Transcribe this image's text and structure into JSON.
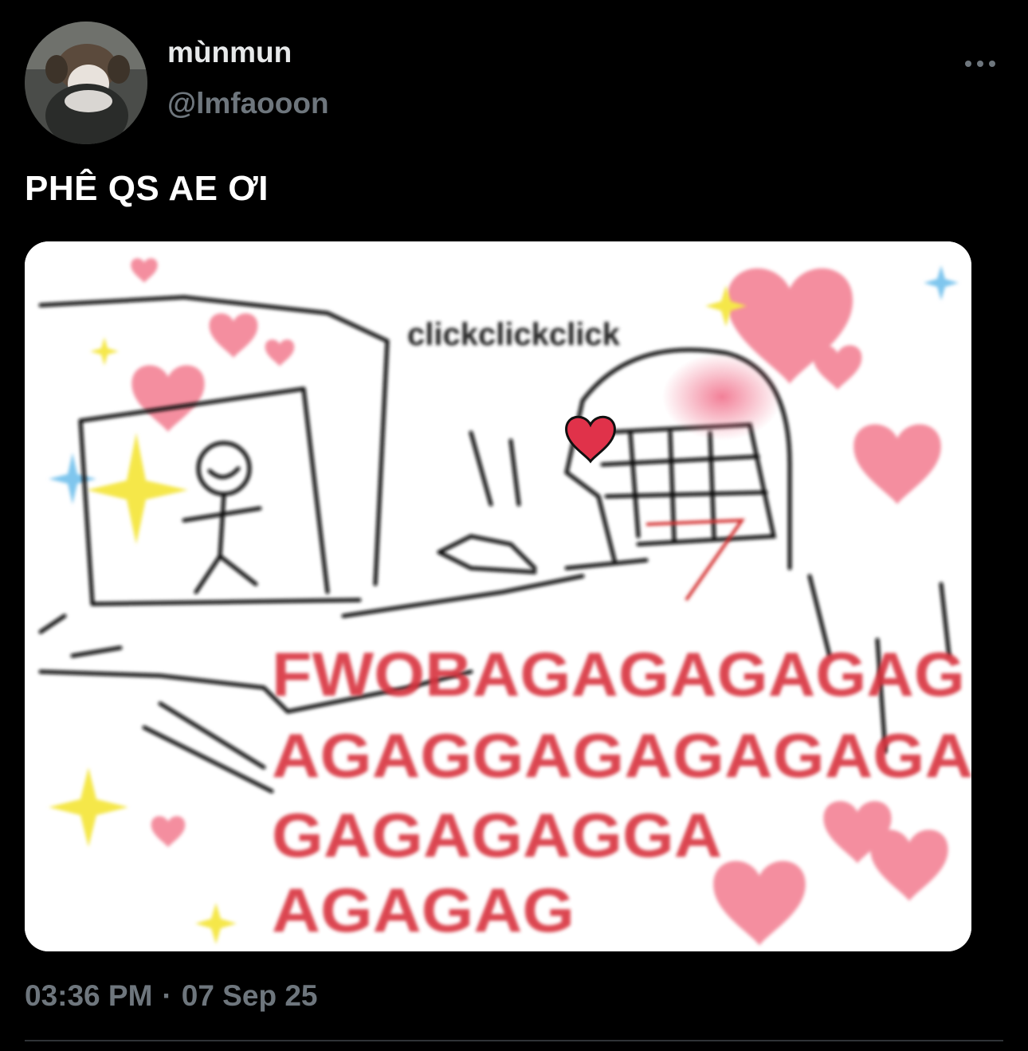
{
  "tweet": {
    "author": {
      "display_name": "mùnmun",
      "handle": "@lmfaooon",
      "avatar_icon": "profile-photo"
    },
    "text": "PHÊ QS AE ƠI",
    "media": {
      "caption_top": "clickclickclick",
      "shout_lines": [
        "FWOBAGAGAGAGAG",
        "AGAGGAGAGAGAGA",
        "GAGAGAGGA",
        "AGAGAG"
      ],
      "shout_color": "#d8323c",
      "heart_color": "#f27a8e"
    },
    "time": "03:36 PM",
    "separator": "·",
    "date": "07 Sep 25",
    "more_icon": "more-horizontal-icon"
  },
  "colors": {
    "background": "#000000",
    "primary_text": "#e7e9ea",
    "secondary_text": "#6e767d",
    "divider": "#2f3336"
  }
}
